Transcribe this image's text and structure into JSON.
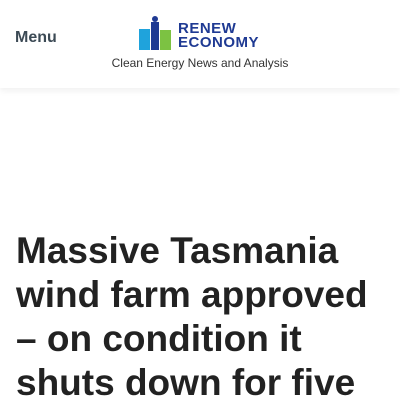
{
  "header": {
    "menu_label": "Menu",
    "logo": {
      "line1": "RENEW",
      "line2": "ECONOMY",
      "colors": {
        "blue": "#1f3a93",
        "green": "#7cc242",
        "cyan": "#1fa3dc"
      }
    },
    "tagline": "Clean Energy News and Analysis"
  },
  "article": {
    "title": "Massive Tasmania wind farm approved – on condition it shuts down for five"
  }
}
